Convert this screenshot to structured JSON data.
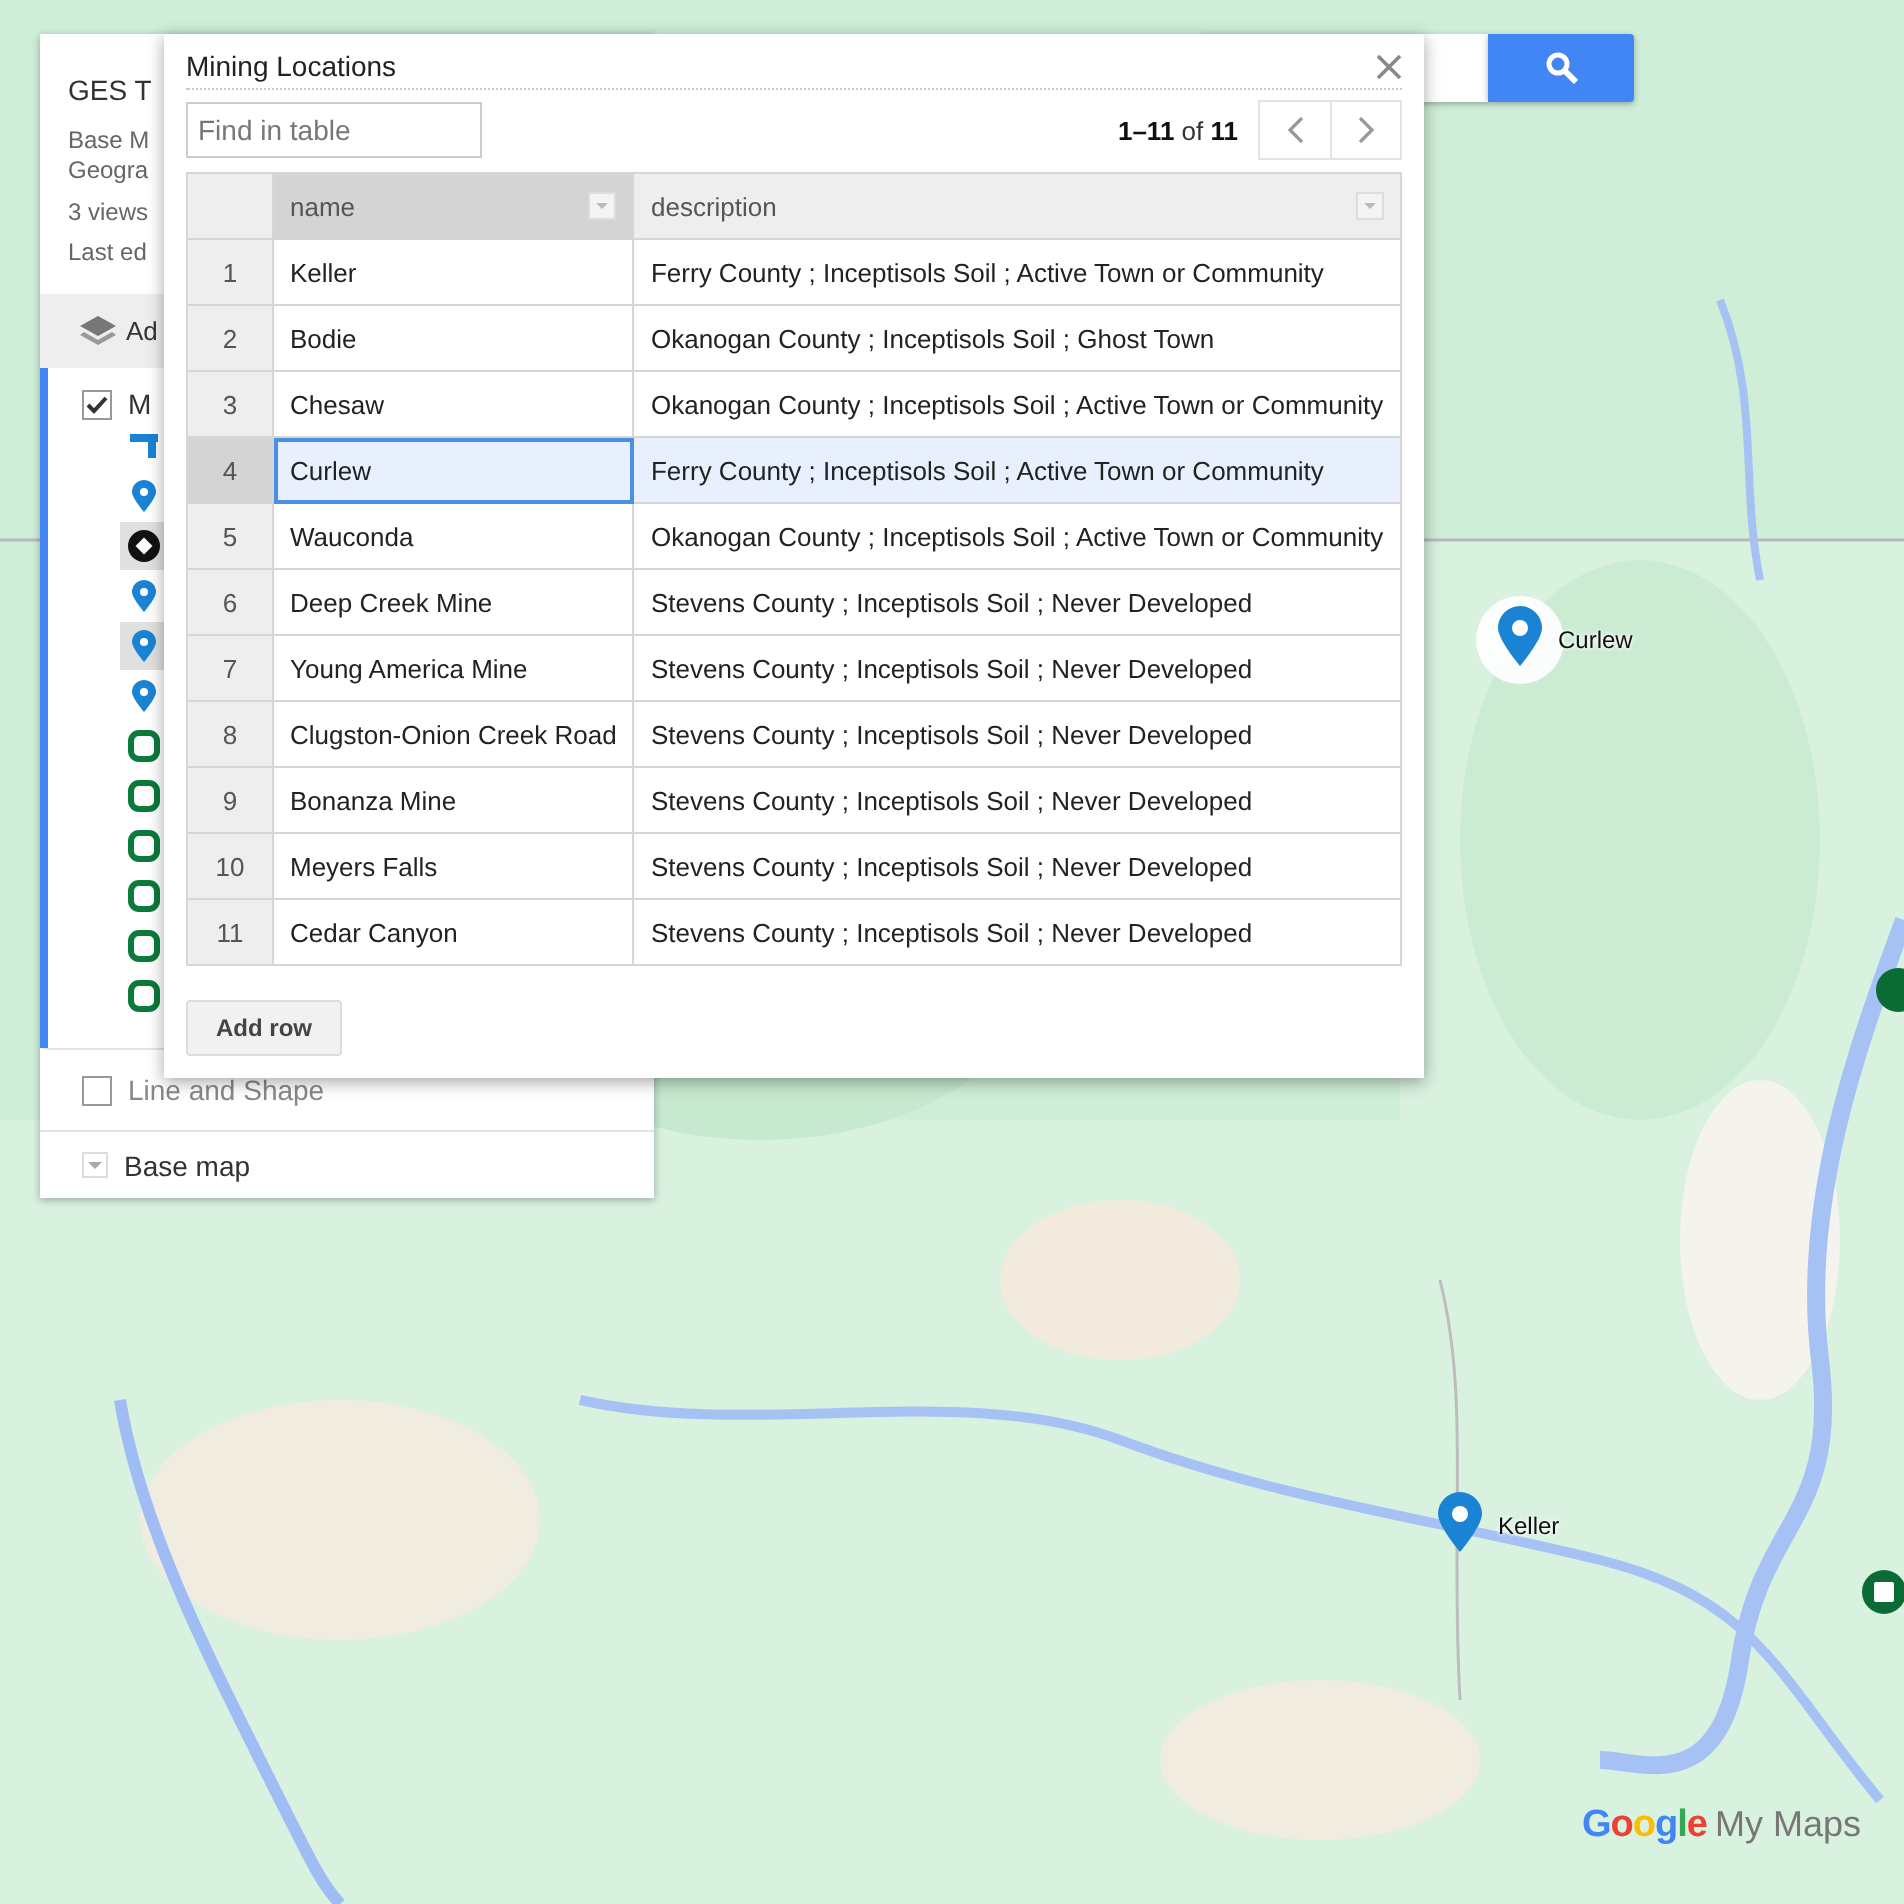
{
  "map": {
    "kind": "picture",
    "markers": [
      {
        "label": "Curlew",
        "highlighted": true
      },
      {
        "label": "Keller",
        "highlighted": false
      }
    ]
  },
  "panel": {
    "title": "GES T",
    "subtitle_lines": [
      "Base M",
      "Geogra"
    ],
    "views": "3 views",
    "last_edited": "Last ed",
    "add_layer": "Ad",
    "layers": [
      {
        "name": "M",
        "checked": true,
        "features": [
          {
            "kind": "line",
            "selected": false
          },
          {
            "kind": "pin",
            "selected": false
          },
          {
            "kind": "diamond",
            "selected": true
          },
          {
            "kind": "pin",
            "selected": false
          },
          {
            "kind": "pin",
            "selected": true
          },
          {
            "kind": "pin",
            "selected": false
          },
          {
            "kind": "square",
            "selected": false
          },
          {
            "kind": "square",
            "selected": false
          },
          {
            "kind": "square",
            "selected": false
          },
          {
            "kind": "square",
            "selected": false
          },
          {
            "kind": "square",
            "selected": false
          },
          {
            "kind": "square",
            "selected": false
          }
        ]
      },
      {
        "name": "Line and Shape",
        "checked": false
      }
    ],
    "base_map": "Base map"
  },
  "table_dialog": {
    "title": "Mining Locations",
    "find": {
      "placeholder": "Find in table"
    },
    "pagination": "**1–11** of **11**",
    "columns": [
      {
        "label": "name",
        "selected": true
      },
      {
        "label": "description",
        "selected": false
      }
    ],
    "rows": [
      {
        "number": "1",
        "name": "Keller",
        "description": "Ferry County ; Inceptisols Soil ; Active Town or Community",
        "selected": false
      },
      {
        "number": "2",
        "name": "Bodie",
        "description": "Okanogan County ; Inceptisols Soil ; Ghost Town",
        "selected": false
      },
      {
        "number": "3",
        "name": "Chesaw",
        "description": "Okanogan County ; Inceptisols Soil ; Active Town or Community",
        "selected": false
      },
      {
        "number": "4",
        "name": "Curlew",
        "description": "Ferry County ; Inceptisols Soil ; Active Town or Community",
        "selected": true
      },
      {
        "number": "5",
        "name": "Wauconda",
        "description": "Okanogan County ; Inceptisols Soil ; Active Town or Community",
        "selected": false
      },
      {
        "number": "6",
        "name": "Deep Creek Mine",
        "description": "Stevens County ; Inceptisols Soil ; Never Developed",
        "selected": false
      },
      {
        "number": "7",
        "name": "Young America Mine",
        "description": "Stevens County ; Inceptisols Soil ; Never Developed",
        "selected": false
      },
      {
        "number": "8",
        "name": "Clugston-Onion Creek Road",
        "description": "Stevens County ; Inceptisols Soil ; Never Developed",
        "selected": false
      },
      {
        "number": "9",
        "name": "Bonanza Mine",
        "description": "Stevens County ; Inceptisols Soil ; Never Developed",
        "selected": false
      },
      {
        "number": "10",
        "name": "Meyers Falls",
        "description": "Stevens County ; Inceptisols Soil ; Never Developed",
        "selected": false
      },
      {
        "number": "11",
        "name": "Cedar Canyon",
        "description": "Stevens County ; Inceptisols Soil ; Never Developed",
        "selected": false
      }
    ],
    "add_row": "Add row"
  },
  "logo": {
    "brand": "Google",
    "product": "My Maps"
  }
}
